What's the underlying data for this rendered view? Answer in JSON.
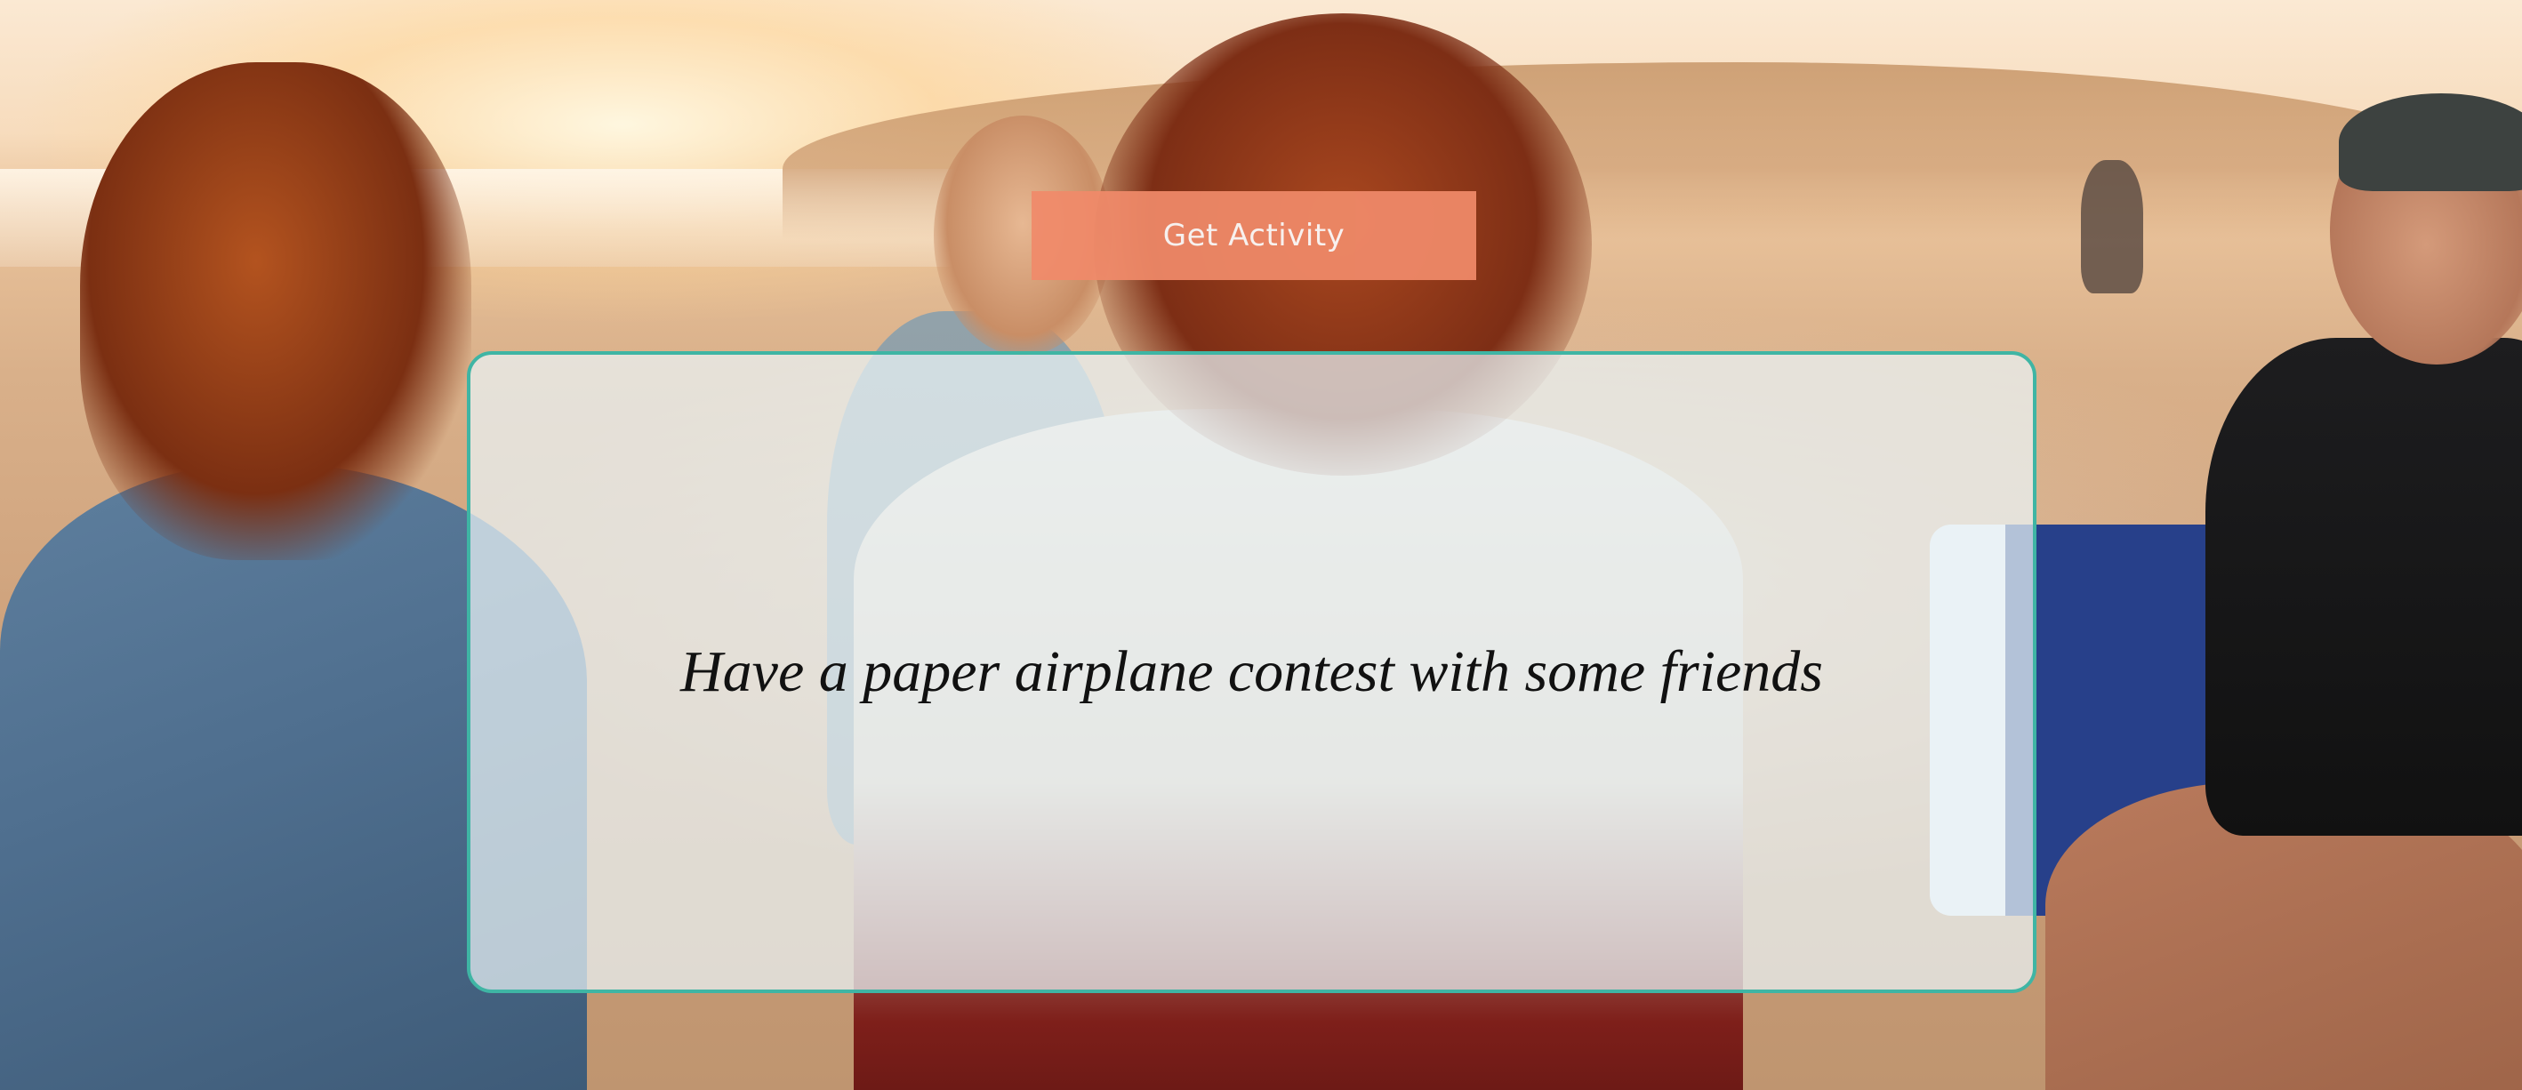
{
  "app": {
    "button_label": "Get Activity",
    "activity_text": "Have a paper airplane contest with some friends"
  },
  "colors": {
    "button_bg": "#f08a69",
    "card_border": "#3fb5a4",
    "card_bg": "#eaf4f6"
  },
  "background": {
    "description_icon": "beach-sunset-photo"
  }
}
